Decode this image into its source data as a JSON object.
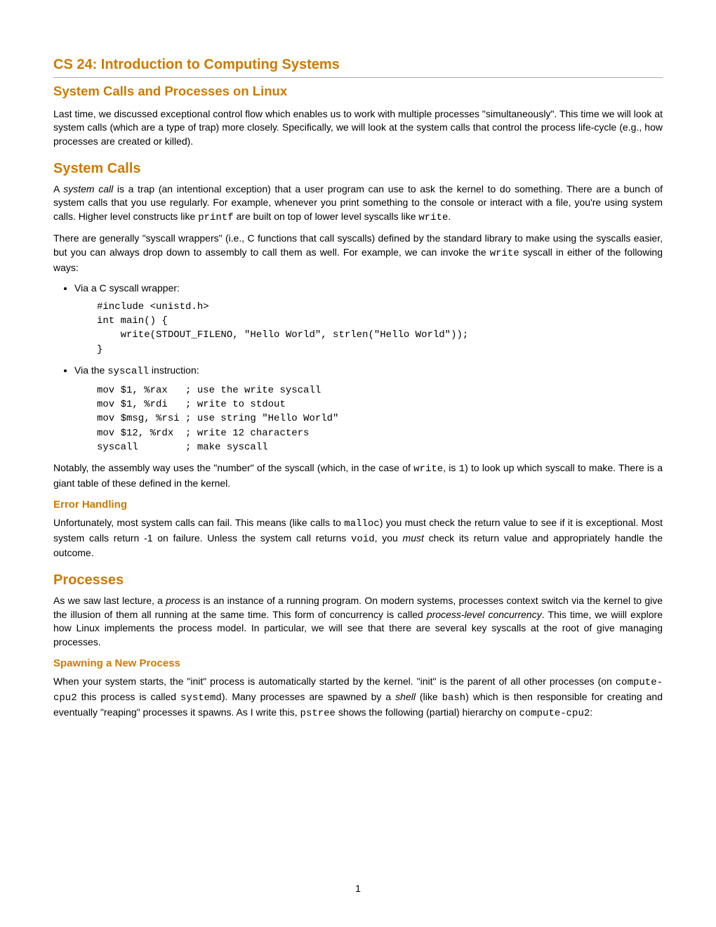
{
  "header": {
    "title": "CS 24: Introduction to Computing Systems",
    "subtitle": "System Calls and Processes on Linux"
  },
  "intro": "Last time, we discussed exceptional control flow which enables us to work with multiple processes \"simultaneously\". This time we will look at system calls (which are a type of trap) more closely. Specifically, we will look at the system calls that control the process life-cycle (e.g., how processes are created or killed).",
  "syscalls": {
    "heading": "System Calls",
    "p1a": "A ",
    "p1b": "system call",
    "p1c": " is a trap (an intentional exception) that a user program can use to ask the kernel to do something. There are a bunch of system calls that you use regularly. For example, whenever you print something to the console or interact with a file, you're using system calls. Higher level constructs like ",
    "p1d": "printf",
    "p1e": " are built on top of lower level syscalls like ",
    "p1f": "write",
    "p1g": ".",
    "p2a": "There are generally \"syscall wrappers\" (i.e., C functions that call syscalls) defined by the standard library to make using the syscalls easier, but you can always drop down to assembly to call them as well. For example, we can invoke the ",
    "p2b": "write",
    "p2c": " syscall in either of the following ways:",
    "bullet1": "Via a C syscall wrapper:",
    "code1": "#include <unistd.h>\nint main() {\n    write(STDOUT_FILENO, \"Hello World\", strlen(\"Hello World\"));\n}",
    "bullet2a": "Via the ",
    "bullet2b": "syscall",
    "bullet2c": " instruction:",
    "code2": "mov $1, %rax   ; use the write syscall\nmov $1, %rdi   ; write to stdout\nmov $msg, %rsi ; use string \"Hello World\"\nmov $12, %rdx  ; write 12 characters\nsyscall        ; make syscall",
    "p3a": "Notably, the assembly way uses the \"number\" of the syscall (which, in the case of ",
    "p3b": "write",
    "p3c": ", is ",
    "p3d": "1",
    "p3e": ") to look up which syscall to make. There is a giant table of these defined in the kernel.",
    "err_heading": "Error Handling",
    "err_a": "Unfortunately, most system calls can fail. This means (like calls to ",
    "err_b": "malloc",
    "err_c": ") you must check the return value to see if it is exceptional. Most system calls return -1 on failure. Unless the system call returns ",
    "err_d": "void",
    "err_e": ", you ",
    "err_f": "must",
    "err_g": " check its return value and appropriately handle the outcome."
  },
  "processes": {
    "heading": "Processes",
    "p1a": "As we saw last lecture, a ",
    "p1b": "process",
    "p1c": " is an instance of a running program. On modern systems, processes context switch via the kernel to give the illusion of them all running at the same time. This form of concurrency is called ",
    "p1d": "process-level concurrency",
    "p1e": ". This time, we wiill explore how Linux implements the process model. In particular, we will see that there are several key syscalls at the root of give managing processes.",
    "spawn_heading": "Spawning a New Process",
    "sp_a": "When your system starts, the \"init\" process is automatically started by the kernel. \"init\" is the parent of all other processes (on ",
    "sp_b": "compute-cpu2",
    "sp_c": " this process is called ",
    "sp_d": "systemd",
    "sp_e": "). Many processes are spawned by a ",
    "sp_f": "shell",
    "sp_g": " (like ",
    "sp_h": "bash",
    "sp_i": ") which is then responsible for creating and eventually \"reaping\" processes it spawns. As I write this, ",
    "sp_j": "pstree",
    "sp_k": " shows the following (partial) hierarchy on ",
    "sp_l": "compute-cpu2",
    "sp_m": ":"
  },
  "page_number": "1"
}
